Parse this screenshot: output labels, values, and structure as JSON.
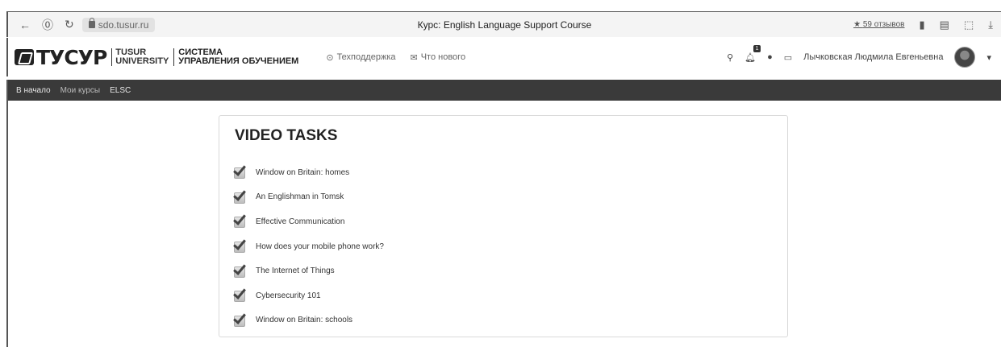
{
  "browser": {
    "url": "sdo.tusur.ru",
    "tab_title": "Курс: English Language Support Course",
    "reviews": "59 отзывов"
  },
  "header": {
    "logo_text": "ТУСУР",
    "logo_uni_line1": "TUSUR",
    "logo_uni_line2": "UNIVERSITY",
    "logo_sys_line1": "СИСТЕМА",
    "logo_sys_line2": "УПРАВЛЕНИЯ ОБУЧЕНИЕМ",
    "support_link": "Техподдержка",
    "news_link": "Что нового",
    "notification_count": "1",
    "user_name": "Лычковская Людмила Евгеньевна"
  },
  "menu": {
    "items": [
      "В начало",
      "Мои курсы",
      "ELSC"
    ]
  },
  "section": {
    "title": "VIDEO TASKS",
    "tasks": [
      "Window on Britain: homes",
      "An Englishman in Tomsk",
      "Effective Communication",
      "How does your mobile phone work?",
      "The Internet of Things",
      "Cybersecurity 101",
      "Window on Britain: schools"
    ]
  }
}
